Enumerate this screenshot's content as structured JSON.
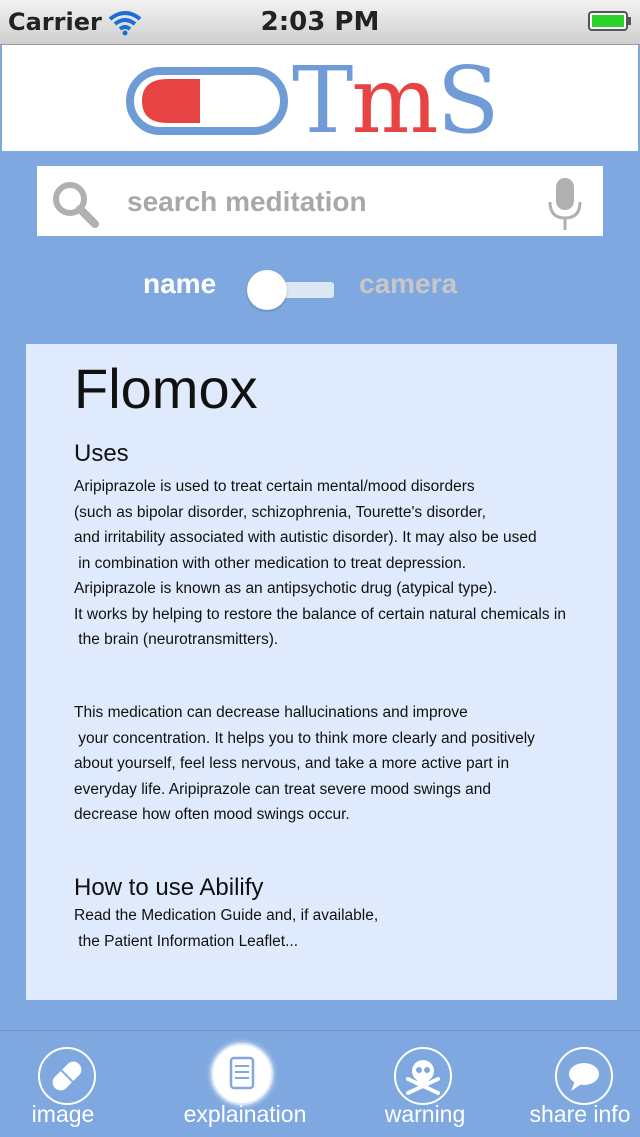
{
  "status_bar": {
    "carrier": "Carrier",
    "time": "2:03 PM"
  },
  "logo": {
    "text_t": "T",
    "text_m": "m",
    "text_s": "S"
  },
  "search": {
    "placeholder": "search meditation"
  },
  "toggle": {
    "left_label": "name",
    "right_label": "camera",
    "selected": "name"
  },
  "content": {
    "title": "Flomox",
    "uses_heading": "Uses",
    "uses_text": "Aripiprazole is used to treat certain mental/mood disorders\n(such as bipolar disorder, schizophrenia, Tourette's disorder,\nand irritability associated with autistic disorder). It may also be used\n in combination with other medication to treat depression.\nAripiprazole is known as an antipsychotic drug (atypical type).\nIt works by helping to restore the balance of certain natural chemicals in\n the brain (neurotransmitters).",
    "effects_text": "This medication can decrease hallucinations and improve\n your concentration. It helps you to think more clearly and positively\nabout yourself, feel less nervous, and take a more active part in\neveryday life. Aripiprazole can treat severe mood swings and\ndecrease how often mood swings occur.",
    "howto_heading": "How to use Abilify",
    "howto_text": "Read the Medication Guide and, if available,\n the Patient Information Leaflet..."
  },
  "tabs": [
    {
      "label": "image",
      "icon": "pill-icon",
      "active": false
    },
    {
      "label": "explaination",
      "icon": "document-icon",
      "active": true
    },
    {
      "label": "warning",
      "icon": "skull-crossbones-icon",
      "active": false
    },
    {
      "label": "share info",
      "icon": "speech-bubble-icon",
      "active": false
    }
  ],
  "colors": {
    "background": "#7ea8df",
    "card": "#dfeafc",
    "logo_blue": "#6f9bd6",
    "logo_red": "#e84343"
  }
}
